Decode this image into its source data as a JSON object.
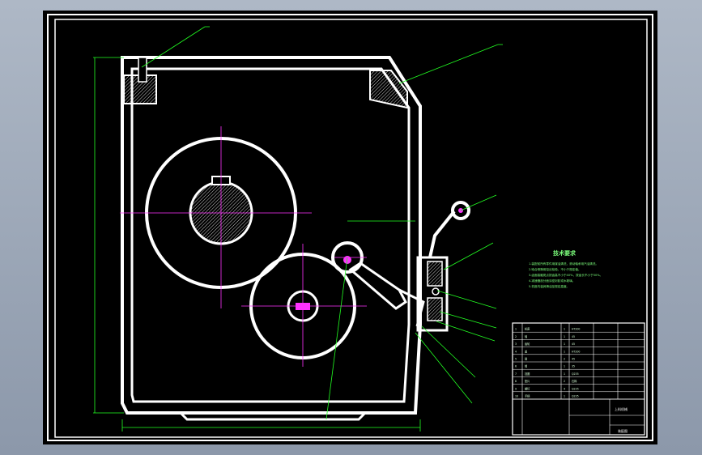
{
  "drawing": {
    "colors": {
      "background": "#000000",
      "outline": "#ffffff",
      "leader": "#22ff22",
      "centerline": "#ff33ff",
      "hatch": "#ffffff"
    },
    "tech_requirements": {
      "title": "技术要求",
      "lines": [
        "1.装配前所有零件用煤油清洗，滚动轴承用汽油清洗。",
        "2.啮合侧隙用铅丝检验，不小于规定值。",
        "3.齿面接触斑点按齿高不小于40%，按齿长不小于50%。",
        "4.减速器剖分面涂密封胶或水玻璃。",
        "5.机座内装润滑油至规定高度。"
      ]
    },
    "title_block": {
      "drawing_name": "上料机械",
      "part_title": "装配图",
      "rows": [
        [
          "1",
          "机座",
          "1",
          "HT200"
        ],
        [
          "2",
          "轴",
          "1",
          "45"
        ],
        [
          "3",
          "齿轮",
          "1",
          "45"
        ],
        [
          "4",
          "盖",
          "1",
          "HT200"
        ],
        [
          "5",
          "键",
          "2",
          "45"
        ],
        [
          "6",
          "销",
          "1",
          "35"
        ],
        [
          "7",
          "挡圈",
          "1",
          "Q235"
        ],
        [
          "8",
          "垫片",
          "2",
          "石棉"
        ],
        [
          "9",
          "螺钉",
          "4",
          "Q235"
        ],
        [
          "10",
          "手柄",
          "1",
          "Q235"
        ]
      ]
    }
  }
}
